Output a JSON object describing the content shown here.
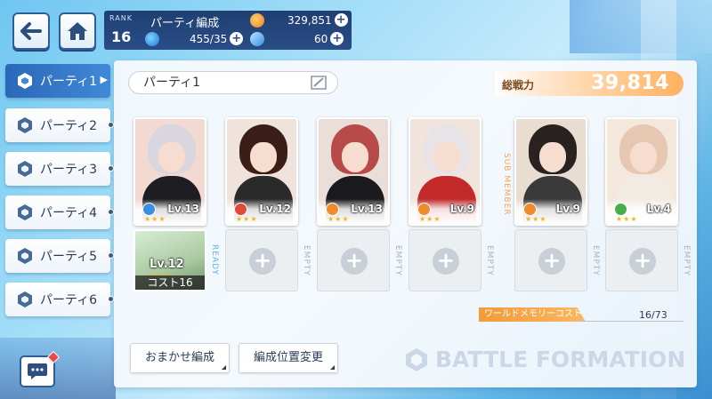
{
  "header": {
    "rank_label": "RANK",
    "rank_value": "16",
    "title": "パーティ編成",
    "coins": "329,851",
    "stamina": "455/35",
    "gems": "60"
  },
  "sidebar": {
    "tabs": [
      {
        "label": "パーティ1",
        "active": true
      },
      {
        "label": "パーティ2",
        "active": false
      },
      {
        "label": "パーティ3",
        "active": false
      },
      {
        "label": "パーティ4",
        "active": false
      },
      {
        "label": "パーティ5",
        "active": false
      },
      {
        "label": "パーティ6",
        "active": false
      }
    ]
  },
  "party": {
    "name": "パーティ1",
    "power_label": "総戦力",
    "power_value": "39,814"
  },
  "slots": [
    {
      "level": "Lv.13",
      "stars": "★★★",
      "attr_color": "#3a8fe0",
      "hair": "#d9d6df",
      "outfit": "#1e1e22",
      "bg": "#f2d9d2",
      "sub": {
        "filled": true,
        "level": "Lv.12",
        "stars": "★★★★",
        "cost": "コスト16"
      },
      "side": "READY"
    },
    {
      "level": "Lv.12",
      "stars": "★★★",
      "attr_color": "#e04a3a",
      "hair": "#3a1e17",
      "outfit": "#2a2a2a",
      "bg": "#efe3dc",
      "sub": {
        "filled": false
      },
      "side": "EMPTY"
    },
    {
      "level": "Lv.13",
      "stars": "★★★",
      "attr_color": "#ef8a2d",
      "hair": "#b84a4a",
      "outfit": "#1a1a1e",
      "bg": "#eadfd8",
      "sub": {
        "filled": false
      },
      "side": "EMPTY"
    },
    {
      "level": "Lv.9",
      "stars": "★★★",
      "attr_color": "#ef8a2d",
      "hair": "#e7e3e6",
      "outfit": "#c22a2a",
      "bg": "#f0e4dd",
      "sub": {
        "filled": false
      },
      "side": "EMPTY"
    },
    {
      "level": "Lv.9",
      "stars": "★★★",
      "attr_color": "#ef8a2d",
      "hair": "#2a2220",
      "outfit": "#3a3a3a",
      "bg": "#e9ddd2",
      "sub": {
        "filled": false
      },
      "side": "EMPTY"
    },
    {
      "level": "Lv.4",
      "stars": "★★★",
      "attr_color": "#45b04a",
      "hair": "#e6c7b2",
      "outfit": "#f1ebe4",
      "bg": "#f4e7dc",
      "sub": {
        "filled": false
      },
      "side": "EMPTY"
    }
  ],
  "sub_member_label": "SUB MEMBER",
  "cost": {
    "label": "ワールドメモリーコスト",
    "value": "16/73",
    "fraction": 0.22
  },
  "buttons": {
    "auto": "おまかせ編成",
    "swap": "編成位置変更"
  },
  "brand": "BATTLE FORMATION",
  "colors": {
    "accent_blue": "#2b67b8",
    "accent_orange": "#f29b3a"
  }
}
